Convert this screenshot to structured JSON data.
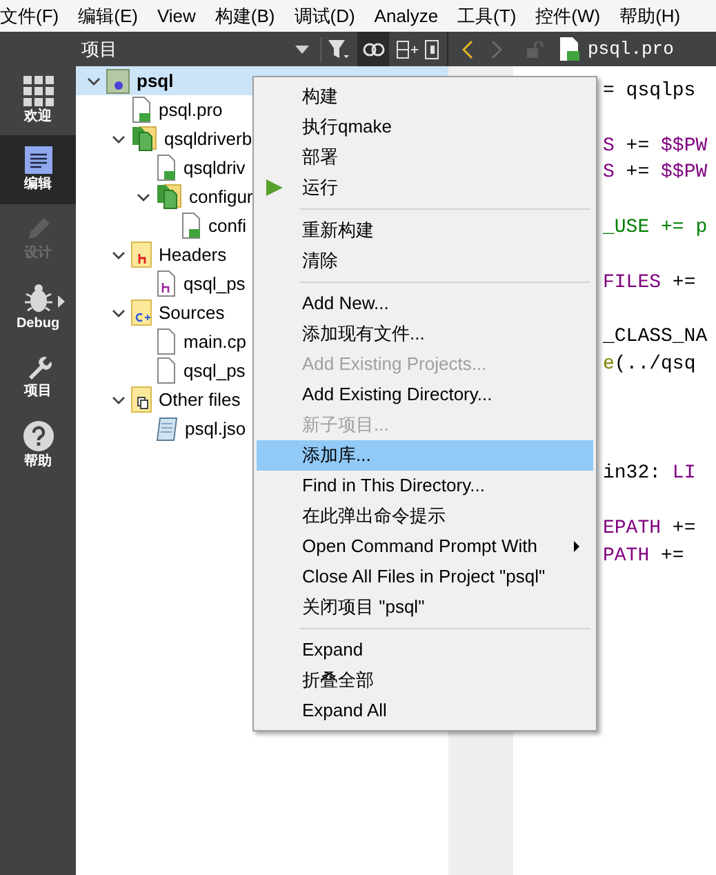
{
  "menubar": [
    {
      "label": "文件(F)"
    },
    {
      "label": "编辑(E)"
    },
    {
      "label": "View"
    },
    {
      "label": "构建(B)"
    },
    {
      "label": "调试(D)"
    },
    {
      "label": "Analyze"
    },
    {
      "label": "工具(T)"
    },
    {
      "label": "控件(W)"
    },
    {
      "label": "帮助(H)"
    }
  ],
  "panel_header": {
    "title": "项目"
  },
  "editor_tab": {
    "file": "psql.pro"
  },
  "modes": [
    {
      "label": "欢迎",
      "kind": "welcome",
      "selected": false,
      "disabled": false
    },
    {
      "label": "编辑",
      "kind": "edit",
      "selected": true,
      "disabled": false
    },
    {
      "label": "设计",
      "kind": "design",
      "selected": false,
      "disabled": true
    },
    {
      "label": "Debug",
      "kind": "debug",
      "selected": false,
      "disabled": false
    },
    {
      "label": "项目",
      "kind": "projects",
      "selected": false,
      "disabled": false
    },
    {
      "label": "帮助",
      "kind": "help",
      "selected": false,
      "disabled": false
    }
  ],
  "tree": [
    {
      "label": "psql",
      "kind": "project",
      "selected": true,
      "expanded": true,
      "children": [
        {
          "label": "psql.pro",
          "kind": "qt-file",
          "selected": false
        },
        {
          "label": "qsqldriverb",
          "kind": "qt-folder",
          "selected": false,
          "expanded": true,
          "children": [
            {
              "label": "qsqldriv",
              "kind": "qt-file",
              "selected": false
            },
            {
              "label": "configur",
              "kind": "qt-folder",
              "selected": false,
              "expanded": true,
              "children": [
                {
                  "label": "confi",
                  "kind": "qt-file",
                  "selected": false
                }
              ]
            }
          ]
        },
        {
          "label": "Headers",
          "kind": "headers-folder",
          "selected": false,
          "expanded": true,
          "children": [
            {
              "label": "qsql_ps",
              "kind": "header-file",
              "selected": false
            }
          ]
        },
        {
          "label": "Sources",
          "kind": "sources-folder",
          "selected": false,
          "expanded": true,
          "children": [
            {
              "label": "main.cp",
              "kind": "source-file",
              "selected": false
            },
            {
              "label": "qsql_ps",
              "kind": "source-file",
              "selected": false
            }
          ]
        },
        {
          "label": "Other files",
          "kind": "other-folder",
          "selected": false,
          "expanded": true,
          "children": [
            {
              "label": "psql.jso",
              "kind": "json-file",
              "selected": false
            }
          ]
        }
      ]
    }
  ],
  "code_lines": [
    {
      "kind": "code",
      "segments": [
        {
          "text": "= qsqlps",
          "kind": "plain"
        }
      ]
    },
    {
      "kind": "blank"
    },
    {
      "kind": "code",
      "segments": [
        {
          "text": "S",
          "kind": "variable"
        },
        {
          "text": " += ",
          "kind": "plain"
        },
        {
          "text": "$$PW",
          "kind": "variable"
        }
      ]
    },
    {
      "kind": "code",
      "segments": [
        {
          "text": "S",
          "kind": "variable"
        },
        {
          "text": " += ",
          "kind": "plain"
        },
        {
          "text": "$$PW",
          "kind": "variable"
        }
      ]
    },
    {
      "kind": "blank"
    },
    {
      "kind": "code",
      "segments": [
        {
          "text": "_USE += p",
          "kind": "keyword"
        }
      ]
    },
    {
      "kind": "blank"
    },
    {
      "kind": "code",
      "segments": [
        {
          "text": "FILES",
          "kind": "variable"
        },
        {
          "text": " +=",
          "kind": "plain"
        }
      ]
    },
    {
      "kind": "blank"
    },
    {
      "kind": "code",
      "segments": [
        {
          "text": "_CLASS_NA",
          "kind": "plain"
        }
      ]
    },
    {
      "kind": "code",
      "segments": [
        {
          "text": "e",
          "kind": "function"
        },
        {
          "text": "(../qsq",
          "kind": "plain"
        }
      ]
    },
    {
      "kind": "blank"
    },
    {
      "kind": "blank"
    },
    {
      "kind": "blank"
    },
    {
      "kind": "code",
      "segments": [
        {
          "text": "in32: ",
          "kind": "plain"
        },
        {
          "text": "LI",
          "kind": "variable"
        }
      ]
    },
    {
      "kind": "blank"
    },
    {
      "kind": "code",
      "segments": [
        {
          "text": "EPATH",
          "kind": "variable"
        },
        {
          "text": " +=",
          "kind": "plain"
        }
      ]
    },
    {
      "kind": "code",
      "segments": [
        {
          "text": "PATH",
          "kind": "variable"
        },
        {
          "text": " +=",
          "kind": "plain"
        }
      ]
    }
  ],
  "context_menu": [
    {
      "kind": "item",
      "label": "构建",
      "disabled": false,
      "selected": false
    },
    {
      "kind": "item",
      "label": "执行qmake",
      "disabled": false,
      "selected": false
    },
    {
      "kind": "item",
      "label": "部署",
      "disabled": false,
      "selected": false
    },
    {
      "kind": "run",
      "label": "运行",
      "disabled": false,
      "selected": false
    },
    {
      "kind": "separator"
    },
    {
      "kind": "item",
      "label": "重新构建",
      "disabled": false,
      "selected": false
    },
    {
      "kind": "item",
      "label": "清除",
      "disabled": false,
      "selected": false
    },
    {
      "kind": "separator"
    },
    {
      "kind": "item",
      "label": "Add New...",
      "disabled": false,
      "selected": false
    },
    {
      "kind": "item",
      "label": "添加现有文件...",
      "disabled": false,
      "selected": false
    },
    {
      "kind": "item",
      "label": "Add Existing Projects...",
      "disabled": true,
      "selected": false
    },
    {
      "kind": "item",
      "label": "Add Existing Directory...",
      "disabled": false,
      "selected": false
    },
    {
      "kind": "item",
      "label": "新子项目...",
      "disabled": true,
      "selected": false
    },
    {
      "kind": "item",
      "label": "添加库...",
      "disabled": false,
      "selected": true
    },
    {
      "kind": "item",
      "label": "Find in This Directory...",
      "disabled": false,
      "selected": false
    },
    {
      "kind": "item",
      "label": "在此弹出命令提示",
      "disabled": false,
      "selected": false
    },
    {
      "kind": "submenu",
      "label": "Open Command Prompt With",
      "disabled": false,
      "selected": false
    },
    {
      "kind": "item",
      "label": "Close All Files in Project \"psql\"",
      "disabled": false,
      "selected": false
    },
    {
      "kind": "item",
      "label": "关闭项目 \"psql\"",
      "disabled": false,
      "selected": false
    },
    {
      "kind": "separator"
    },
    {
      "kind": "item",
      "label": "Expand",
      "disabled": false,
      "selected": false
    },
    {
      "kind": "item",
      "label": "折叠全部",
      "disabled": false,
      "selected": false
    },
    {
      "kind": "item",
      "label": "Expand All",
      "disabled": false,
      "selected": false
    }
  ]
}
